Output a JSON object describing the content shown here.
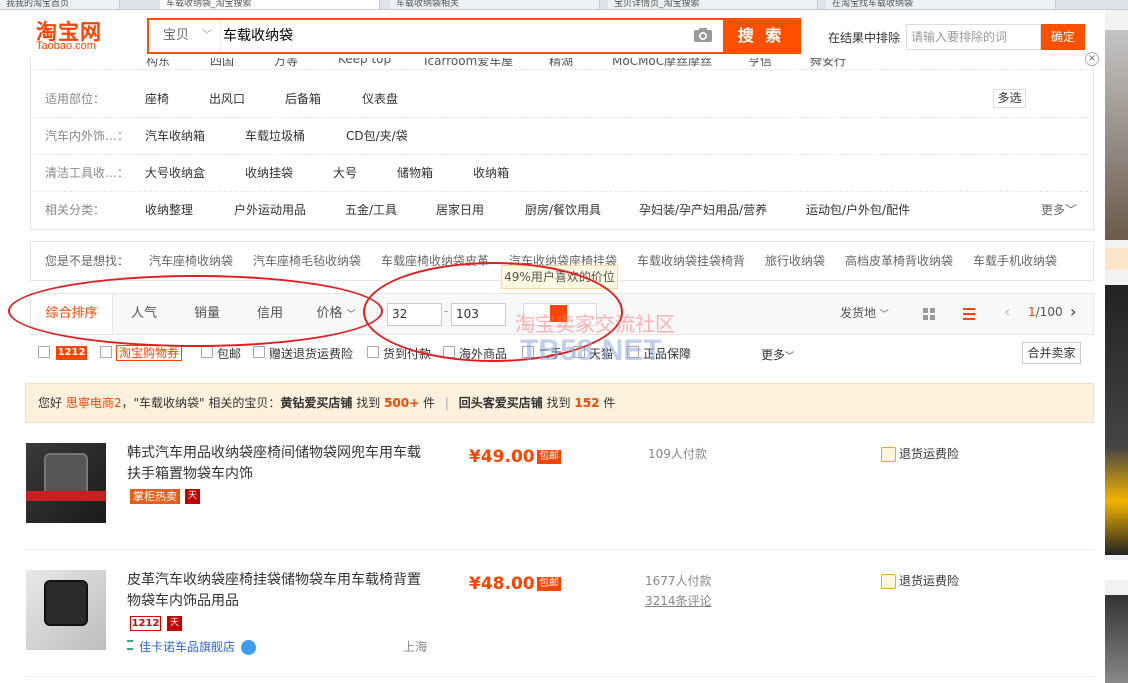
{
  "browser": {
    "tabs": [
      "我我的淘宝首页",
      "车载收纳袋_淘宝搜索",
      "车载收纳袋相关",
      "宝贝详情页_淘宝搜索",
      "在淘宝找车载收纳袋"
    ]
  },
  "header": {
    "logo_cn": "淘宝网",
    "logo_en": "Taobao.com",
    "search_category": "宝贝",
    "search_query": "车载收纳袋",
    "search_button": "搜 索",
    "exclude_label": "在结果中排除",
    "exclude_placeholder": "请输入要排除的词",
    "exclude_button": "确定"
  },
  "filters": {
    "cut_row": [
      "构东",
      "四国",
      "万等",
      "Keep top",
      "Icarroom爱车屋",
      "精湖",
      "MoCMoC摩丝摩丝",
      "亨信",
      "舜安行"
    ],
    "rows": [
      {
        "label": "适用部位：",
        "items": [
          "座椅",
          "出风口",
          "后备箱",
          "仪表盘"
        ]
      },
      {
        "label": "汽车内外饰…：",
        "items": [
          "汽车收纳箱",
          "车载垃圾桶",
          "CD包/夹/袋"
        ]
      },
      {
        "label": "清洁工具收…：",
        "items": [
          "大号收纳盒",
          "收纳挂袋",
          "大号",
          "储物箱",
          "收纳箱"
        ]
      },
      {
        "label": "相关分类：",
        "items": [
          "收纳整理",
          "户外运动用品",
          "五金/工具",
          "居家日用",
          "厨房/餐饮用具",
          "孕妇装/孕产妇用品/营养",
          "运动包/户外包/配件"
        ]
      }
    ],
    "multi_select": "多选",
    "more": "更多"
  },
  "suggestions": {
    "label": "您是不是想找：",
    "items": [
      "汽车座椅收纳袋",
      "汽车座椅毛毡收纳袋",
      "车载座椅收纳袋皮革",
      "汽车收纳袋座椅挂袋",
      "车载收纳袋挂袋椅背",
      "旅行收纳袋",
      "高档皮革椅背收纳袋",
      "车载手机收纳袋"
    ]
  },
  "price_tip": "49%用户喜欢的价位",
  "sort": {
    "items": [
      "综合排序",
      "人气",
      "销量",
      "信用",
      "价格"
    ],
    "price_min": "32",
    "price_max": "103",
    "ship_from": "发货地",
    "page": "1/100"
  },
  "options": {
    "badge": "1212",
    "coupon": "淘宝购物券",
    "items": [
      "包邮",
      "赠送退货运费险",
      "货到付款",
      "海外商品",
      "二手",
      "天猫",
      "正品保障"
    ],
    "more": "更多",
    "merge": "合并卖家"
  },
  "notice": {
    "hello": "您好",
    "user": "思寧电商2",
    "mid": "，\"车载收纳袋\" 相关的宝贝：",
    "shop1": "黄钻爱买店铺",
    "found1": "找到",
    "count1": "500+",
    "unit1": "件",
    "sep": "|",
    "shop2": "回头客爱买店铺",
    "found2": "找到",
    "count2": "152",
    "unit2": "件"
  },
  "products": [
    {
      "title": "韩式汽车用品收纳袋座椅间储物袋网兜车用车载扶手箱置物袋车内饰",
      "price": "¥49.00",
      "mail": "包邮",
      "paid": "109人付款",
      "return": "退货运费险",
      "tag": "掌柜热卖",
      "tmall": "天"
    },
    {
      "title": "皮革汽车收纳袋座椅挂袋储物袋车用车载椅背置物袋车内饰品用品",
      "price": "¥48.00",
      "mail": "包邮",
      "paid": "1677人付款",
      "reviews": "3214条评论",
      "return": "退货运费险",
      "badge": "1212",
      "tmall": "天",
      "shop": "佳卡诺车品旗舰店",
      "location": "上海"
    }
  ],
  "watermark": {
    "line1": "淘宝卖家交流社区",
    "line2": "TB58.NET"
  },
  "colors": {
    "accent": "#ff5000",
    "price": "#ff4400",
    "notice_bg": "#fdf0dd"
  }
}
